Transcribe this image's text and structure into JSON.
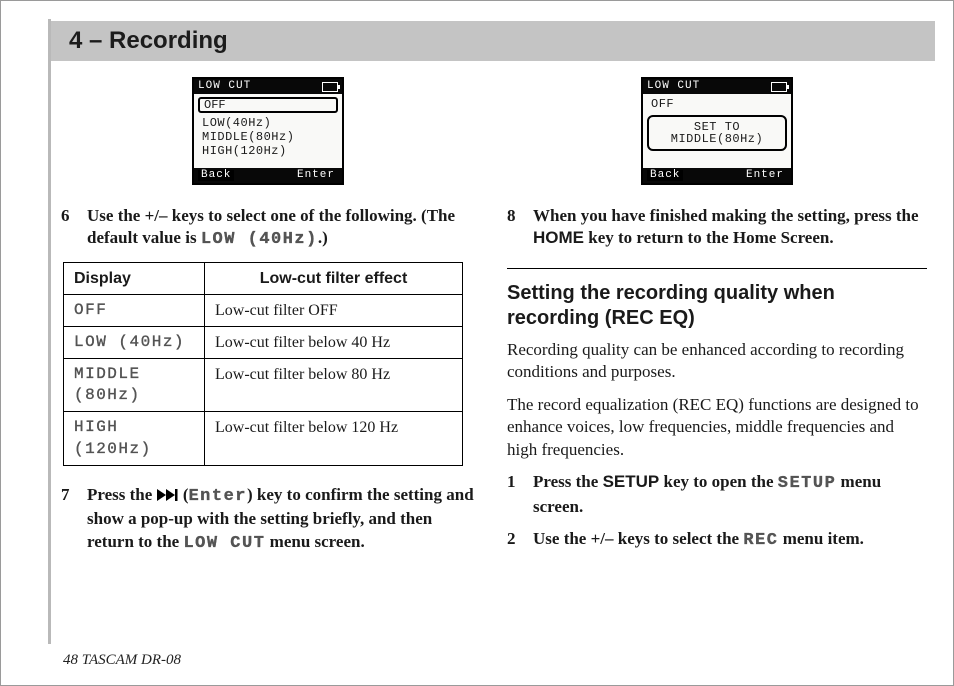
{
  "header": {
    "chapter": "4 – Recording"
  },
  "lcd_left": {
    "title": "LOW CUT",
    "selected": "OFF",
    "options": [
      "LOW(40Hz)",
      "MIDDLE(80Hz)",
      "HIGH(120Hz)"
    ],
    "btn_left": "Back",
    "btn_right": "Enter"
  },
  "lcd_right": {
    "title": "LOW CUT",
    "line1": "OFF",
    "popup_l1": "SET TO",
    "popup_l2": "MIDDLE(80Hz)",
    "btn_left": "Back",
    "btn_right": "Enter"
  },
  "steps": {
    "s6_num": "6",
    "s6_a": "Use the +/– keys to select one of the following. (The default value is ",
    "s6_code": "LOW (40Hz)",
    "s6_b": ".)",
    "s7_num": "7",
    "s7_a": "Press the ",
    "s7_code1": "Enter",
    "s7_b": ") key to confirm the setting and show a pop-up with the setting briefly, and then return to the ",
    "s7_code2": "LOW CUT",
    "s7_c": " menu screen.",
    "s8_num": "8",
    "s8_a": "When you have finished making the setting, press the ",
    "s8_key": "HOME",
    "s8_b": " key to return to the Home Screen.",
    "s1_num": "1",
    "s1_a": "Press the ",
    "s1_key": "SETUP",
    "s1_b": " key to open the ",
    "s1_code": "SETUP",
    "s1_c": " menu screen.",
    "s2_num": "2",
    "s2_a": "Use the +/– keys to select the ",
    "s2_code": "REC",
    "s2_b": " menu item.",
    "open_paren": " ("
  },
  "table": {
    "h1": "Display",
    "h2": "Low-cut filter effect",
    "rows": [
      {
        "d": "OFF",
        "e": "Low-cut filter OFF"
      },
      {
        "d": "LOW (40Hz)",
        "e": "Low-cut filter below 40 Hz"
      },
      {
        "d": "MIDDLE (80Hz)",
        "e": "Low-cut filter below 80 Hz"
      },
      {
        "d": "HIGH (120Hz)",
        "e": "Low-cut filter below 120 Hz"
      }
    ]
  },
  "section2": {
    "heading": "Setting the recording quality when recording (REC EQ)",
    "p1": "Recording quality can be enhanced according to recording conditions and purposes.",
    "p2": "The record equalization (REC EQ) functions are designed to enhance voices, low frequencies, middle frequencies and high frequencies."
  },
  "footer": {
    "page": "48",
    "model": " TASCAM  DR-08"
  }
}
